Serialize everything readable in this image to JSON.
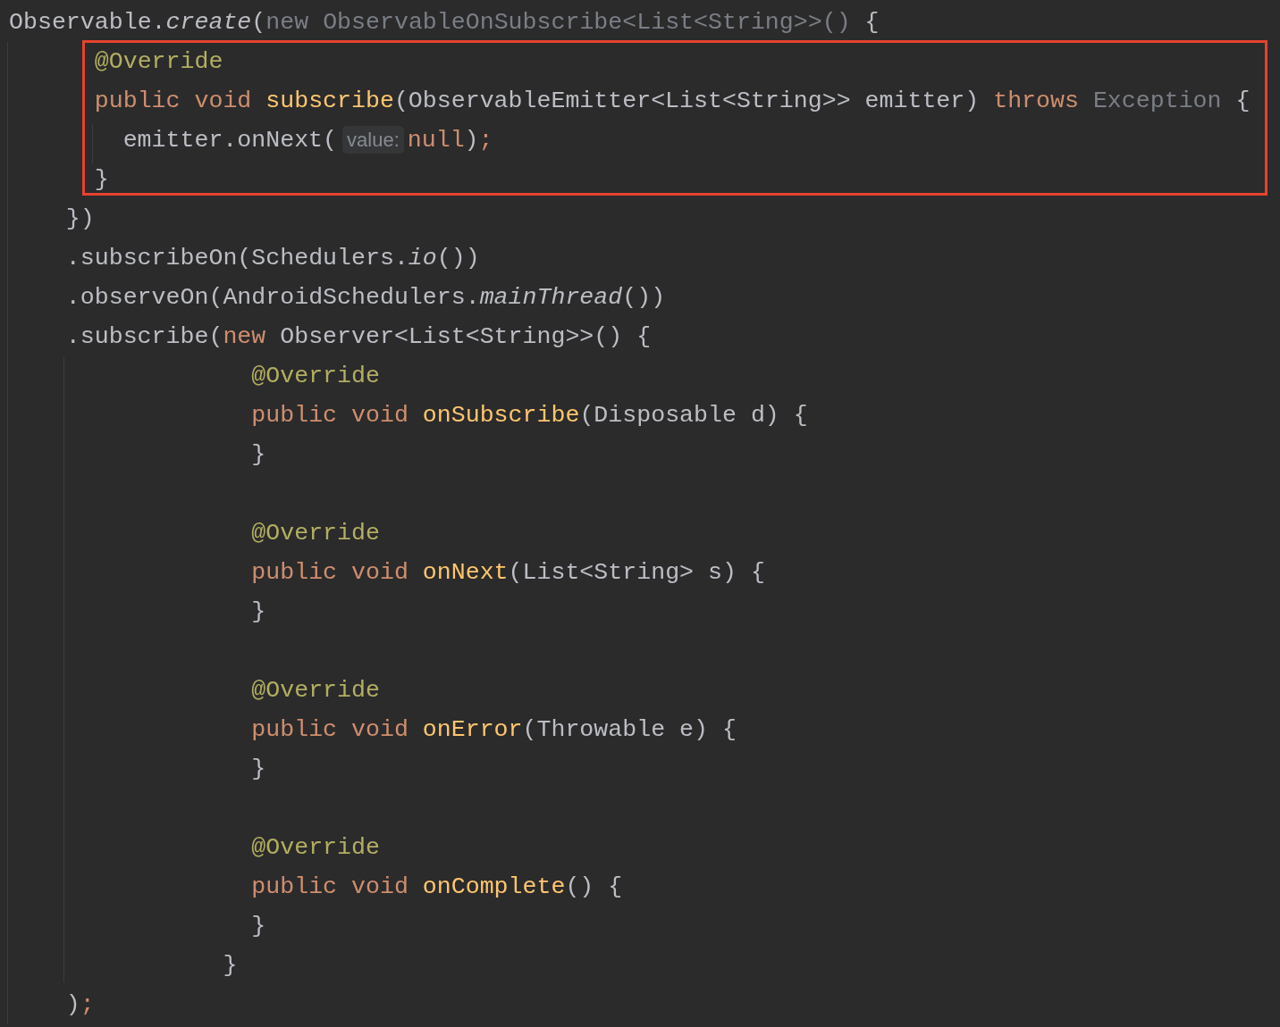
{
  "editor": {
    "blocks": [
      {
        "highlighted": false,
        "lines": [
          {
            "kind": "top",
            "tokens": [
              {
                "kind": "plain",
                "text": "Observable."
              },
              {
                "kind": "italic",
                "text": "create"
              },
              {
                "kind": "plain",
                "text": "("
              },
              {
                "kind": "dim",
                "text": "new ObservableOnSubscribe<List<String>>()"
              },
              {
                "kind": "plain",
                "text": " {"
              }
            ]
          }
        ]
      },
      {
        "highlighted": true,
        "lines": [
          {
            "kind": "member",
            "tokens": [
              {
                "kind": "annotation",
                "text": "@Override"
              }
            ]
          },
          {
            "kind": "member",
            "tokens": [
              {
                "kind": "keyword",
                "text": "public void "
              },
              {
                "kind": "method",
                "text": "subscribe"
              },
              {
                "kind": "plain",
                "text": "(ObservableEmitter<List<String>> emitter) "
              },
              {
                "kind": "keyword",
                "text": "throws "
              },
              {
                "kind": "dim",
                "text": "Exception"
              },
              {
                "kind": "plain",
                "text": " {"
              }
            ]
          },
          {
            "kind": "body",
            "tokens": [
              {
                "kind": "plain",
                "text": "emitter.onNext("
              },
              {
                "kind": "hint",
                "text": "value:"
              },
              {
                "kind": "keyword",
                "text": "null"
              },
              {
                "kind": "plain",
                "text": ")"
              },
              {
                "kind": "keyword",
                "text": ";"
              }
            ]
          },
          {
            "kind": "member",
            "tokens": [
              {
                "kind": "plain",
                "text": "}"
              }
            ]
          }
        ]
      },
      {
        "highlighted": false,
        "lines": [
          {
            "kind": "chain",
            "tokens": [
              {
                "kind": "plain",
                "text": "})"
              }
            ]
          },
          {
            "kind": "chain",
            "tokens": [
              {
                "kind": "plain",
                "text": ".subscribeOn(Schedulers."
              },
              {
                "kind": "italic",
                "text": "io"
              },
              {
                "kind": "plain",
                "text": "())"
              }
            ]
          },
          {
            "kind": "chain",
            "tokens": [
              {
                "kind": "plain",
                "text": ".observeOn(AndroidSchedulers."
              },
              {
                "kind": "italic",
                "text": "mainThread"
              },
              {
                "kind": "plain",
                "text": "())"
              }
            ]
          },
          {
            "kind": "chain",
            "tokens": [
              {
                "kind": "plain",
                "text": ".subscribe("
              },
              {
                "kind": "keyword",
                "text": "new "
              },
              {
                "kind": "plain",
                "text": "Observer<List<String>>() {"
              }
            ]
          },
          {
            "kind": "inner-member",
            "tokens": [
              {
                "kind": "annotation",
                "text": "@Override"
              }
            ]
          },
          {
            "kind": "inner-member",
            "tokens": [
              {
                "kind": "keyword",
                "text": "public void "
              },
              {
                "kind": "method",
                "text": "onSubscribe"
              },
              {
                "kind": "plain",
                "text": "(Disposable d) {"
              }
            ]
          },
          {
            "kind": "inner-member",
            "tokens": [
              {
                "kind": "plain",
                "text": "}"
              }
            ]
          },
          {
            "kind": "blank"
          },
          {
            "kind": "inner-member",
            "tokens": [
              {
                "kind": "annotation",
                "text": "@Override"
              }
            ]
          },
          {
            "kind": "inner-member",
            "tokens": [
              {
                "kind": "keyword",
                "text": "public void "
              },
              {
                "kind": "method",
                "text": "onNext"
              },
              {
                "kind": "plain",
                "text": "(List<String> s) {"
              }
            ]
          },
          {
            "kind": "inner-member",
            "tokens": [
              {
                "kind": "plain",
                "text": "}"
              }
            ]
          },
          {
            "kind": "blank"
          },
          {
            "kind": "inner-member",
            "tokens": [
              {
                "kind": "annotation",
                "text": "@Override"
              }
            ]
          },
          {
            "kind": "inner-member",
            "tokens": [
              {
                "kind": "keyword",
                "text": "public void "
              },
              {
                "kind": "method",
                "text": "onError"
              },
              {
                "kind": "plain",
                "text": "(Throwable e) {"
              }
            ]
          },
          {
            "kind": "inner-member",
            "tokens": [
              {
                "kind": "plain",
                "text": "}"
              }
            ]
          },
          {
            "kind": "blank"
          },
          {
            "kind": "inner-member",
            "tokens": [
              {
                "kind": "annotation",
                "text": "@Override"
              }
            ]
          },
          {
            "kind": "inner-member",
            "tokens": [
              {
                "kind": "keyword",
                "text": "public void "
              },
              {
                "kind": "method",
                "text": "onComplete"
              },
              {
                "kind": "plain",
                "text": "() {"
              }
            ]
          },
          {
            "kind": "inner-member",
            "tokens": [
              {
                "kind": "plain",
                "text": "}"
              }
            ]
          },
          {
            "kind": "inner-close",
            "tokens": [
              {
                "kind": "plain",
                "text": "}"
              }
            ]
          },
          {
            "kind": "chain",
            "tokens": [
              {
                "kind": "plain",
                "text": ")"
              },
              {
                "kind": "keyword",
                "text": ";"
              }
            ]
          }
        ]
      }
    ]
  }
}
